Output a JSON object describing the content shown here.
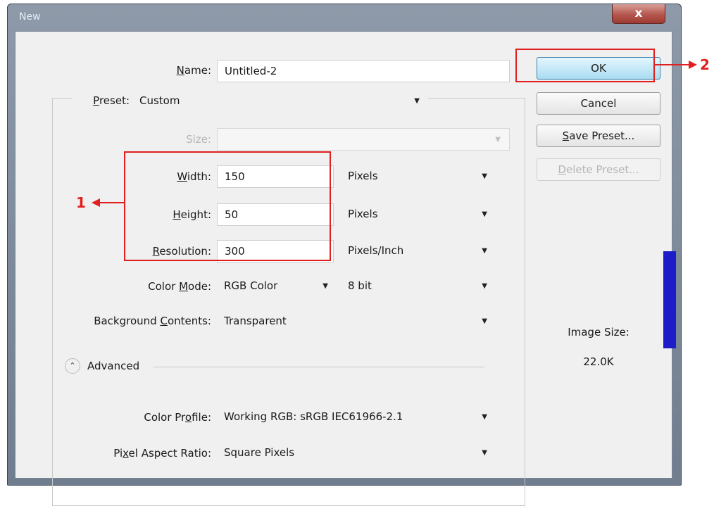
{
  "window": {
    "title": "New",
    "close_glyph": "x"
  },
  "name": {
    "label": "Name:",
    "mnemonic": "N",
    "label_rest": "ame:",
    "value": "Untitled-2"
  },
  "preset": {
    "label_mn": "P",
    "label_rest": "reset:",
    "value": "Custom"
  },
  "size": {
    "label": "Size:",
    "value": ""
  },
  "width": {
    "label_mn": "W",
    "label_rest": "idth:",
    "value": "150",
    "unit": "Pixels"
  },
  "height": {
    "label_mn": "H",
    "label_rest": "eight:",
    "value": "50",
    "unit": "Pixels"
  },
  "resolution": {
    "label_mn": "R",
    "label_rest": "esolution:",
    "value": "300",
    "unit": "Pixels/Inch"
  },
  "color_mode": {
    "label_pre": "Color ",
    "label_mn": "M",
    "label_rest": "ode:",
    "value": "RGB Color",
    "depth": "8 bit"
  },
  "background": {
    "label_pre": "Background ",
    "label_mn": "C",
    "label_rest": "ontents:",
    "value": "Transparent"
  },
  "advanced": {
    "label": "Advanced"
  },
  "color_profile": {
    "label_pre": "Color Pr",
    "label_mn": "o",
    "label_rest": "file:",
    "value": "Working RGB:  sRGB IEC61966-2.1"
  },
  "pixel_aspect": {
    "label_pre": "Pi",
    "label_mn": "x",
    "label_rest": "el Aspect Ratio:",
    "value": "Square Pixels"
  },
  "buttons": {
    "ok": "OK",
    "cancel": "Cancel",
    "save_mn": "S",
    "save_rest": "ave Preset...",
    "delete_mn": "D",
    "delete_rest": "elete Preset..."
  },
  "image_size": {
    "label": "Image Size:",
    "value": "22.0K"
  },
  "annotations": {
    "one": "1",
    "two": "2",
    "color": "#e02020"
  }
}
